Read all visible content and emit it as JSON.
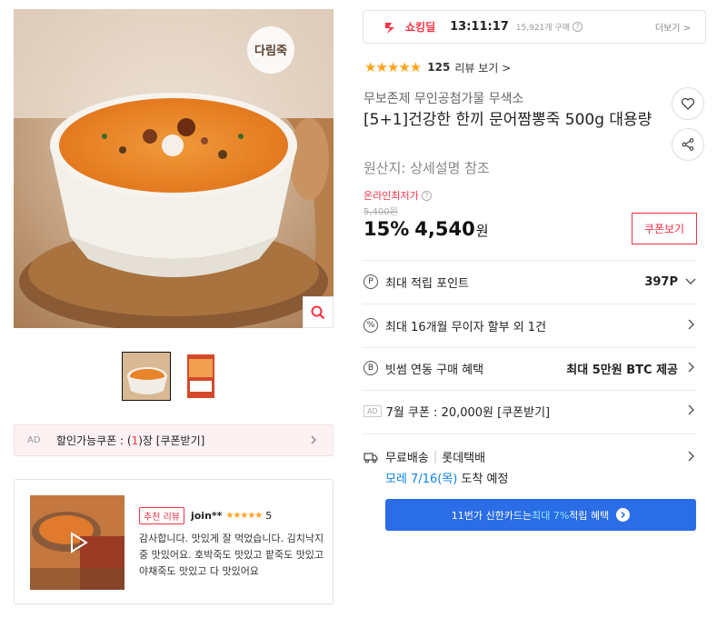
{
  "gallery": {
    "brand_logo_text": "다림죽",
    "zoom_icon": "search-icon",
    "thumbnails": [
      "porridge-bowl",
      "package"
    ]
  },
  "coupon_bar": {
    "ad": "AD",
    "prefix": "할인가능쿠폰 : (",
    "count": "1",
    "suffix": ")장 [쿠폰받기]"
  },
  "review": {
    "badge": "추천 리뷰",
    "user": "join**",
    "stars": "★★★★★",
    "score": "5",
    "text": "감사합니다. 맛있게 잘 먹었습니다. 김치낙지 중 맛있어요. 호박죽도 맛있고 팥죽도 맛있고 야채죽도 맛있고 다 맛있어요"
  },
  "deal": {
    "label": "쇼킹딜",
    "timer": "13:11:17",
    "purchases": "15,921개 구매",
    "help": "?",
    "more": "더보기 >"
  },
  "rating": {
    "stars": "★★★★★",
    "value": 4.5,
    "count": "125",
    "link": "리뷰 보기 >"
  },
  "product": {
    "seller": "무보존제 무인공첨가물 무색소",
    "title": "[5+1]건강한 한끼 문어짬뽕죽 500g 대용량",
    "origin": "원산지: 상세설명 참조"
  },
  "price": {
    "lowest_label": "온라인최저가",
    "help": "?",
    "original": "5,400원",
    "discount": "15%",
    "final": "4,540",
    "unit": "원",
    "coupon_button": "쿠폰보기"
  },
  "benefits": [
    {
      "icon": "P",
      "label": "최대 적립 포인트",
      "value": "397P"
    },
    {
      "icon": "%",
      "label": "최대 16개월 무이자 할부 외 1건",
      "value": ""
    },
    {
      "icon": "B",
      "label": "빗썸 연동 구매 혜택",
      "value": "최대 5만원 BTC 제공"
    },
    {
      "icon": "AD",
      "label": "7월 쿠폰 : 20,000원 [쿠폰받기]",
      "value": ""
    }
  ],
  "shipping": {
    "free": "무료배송",
    "carrier": "롯데택배",
    "date": "모레 7/16(목)",
    "date_rest": " 도착 예정"
  },
  "card_banner": {
    "prefix": "11번가 신한카드는 ",
    "highlight": "최대 7%",
    "suffix": " 적립 혜택"
  },
  "colors": {
    "accent_red": "#f43142",
    "link_blue": "#0b83e6",
    "banner_blue": "#2a6de7",
    "star": "#ffa31a"
  }
}
